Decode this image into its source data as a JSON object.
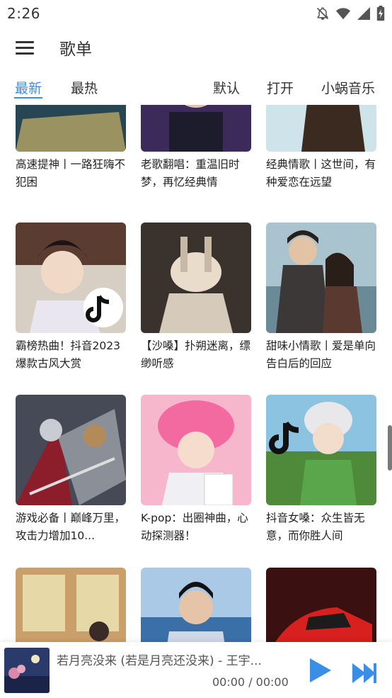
{
  "status": {
    "time": "2:26",
    "icons": [
      "notifications-off-icon",
      "wifi-icon",
      "signal-icon",
      "battery-charging-icon"
    ]
  },
  "app_bar": {
    "menu_icon": "menu-icon",
    "title": "歌单"
  },
  "tabs": {
    "left": [
      {
        "label": "最新",
        "active": true
      },
      {
        "label": "最热",
        "active": false
      }
    ],
    "right": [
      {
        "label": "默认"
      },
      {
        "label": "打开"
      },
      {
        "label": "小蜗音乐"
      }
    ],
    "accent": "#3a8ee6"
  },
  "playlists": [
    {
      "title": "高速提神丨一路狂嗨不犯困"
    },
    {
      "title": "老歌翻唱：重温旧时梦，再忆经典情"
    },
    {
      "title": "经典情歌丨这世间，有种爱恋在远望"
    },
    {
      "title": "霸榜热曲！抖音2023爆款古风大赏"
    },
    {
      "title": "【沙嗓】扑朔迷离，缥缈听感"
    },
    {
      "title": "甜味小情歌丨爱是单向告白后的回应"
    },
    {
      "title": "游戏必备丨巅峰万里，攻击力增加10..."
    },
    {
      "title": "K-pop：出圈神曲，心动探测器！"
    },
    {
      "title": "抖音女嗓：众生皆无意，而你胜人间"
    },
    {
      "title": ""
    },
    {
      "title": ""
    },
    {
      "title": ""
    }
  ],
  "player": {
    "song": "若月亮没来 (若是月亮还没来) - 王宇...",
    "time": "00:00 / 00:00",
    "play_icon": "play-icon",
    "next_icon": "skip-next-icon"
  }
}
